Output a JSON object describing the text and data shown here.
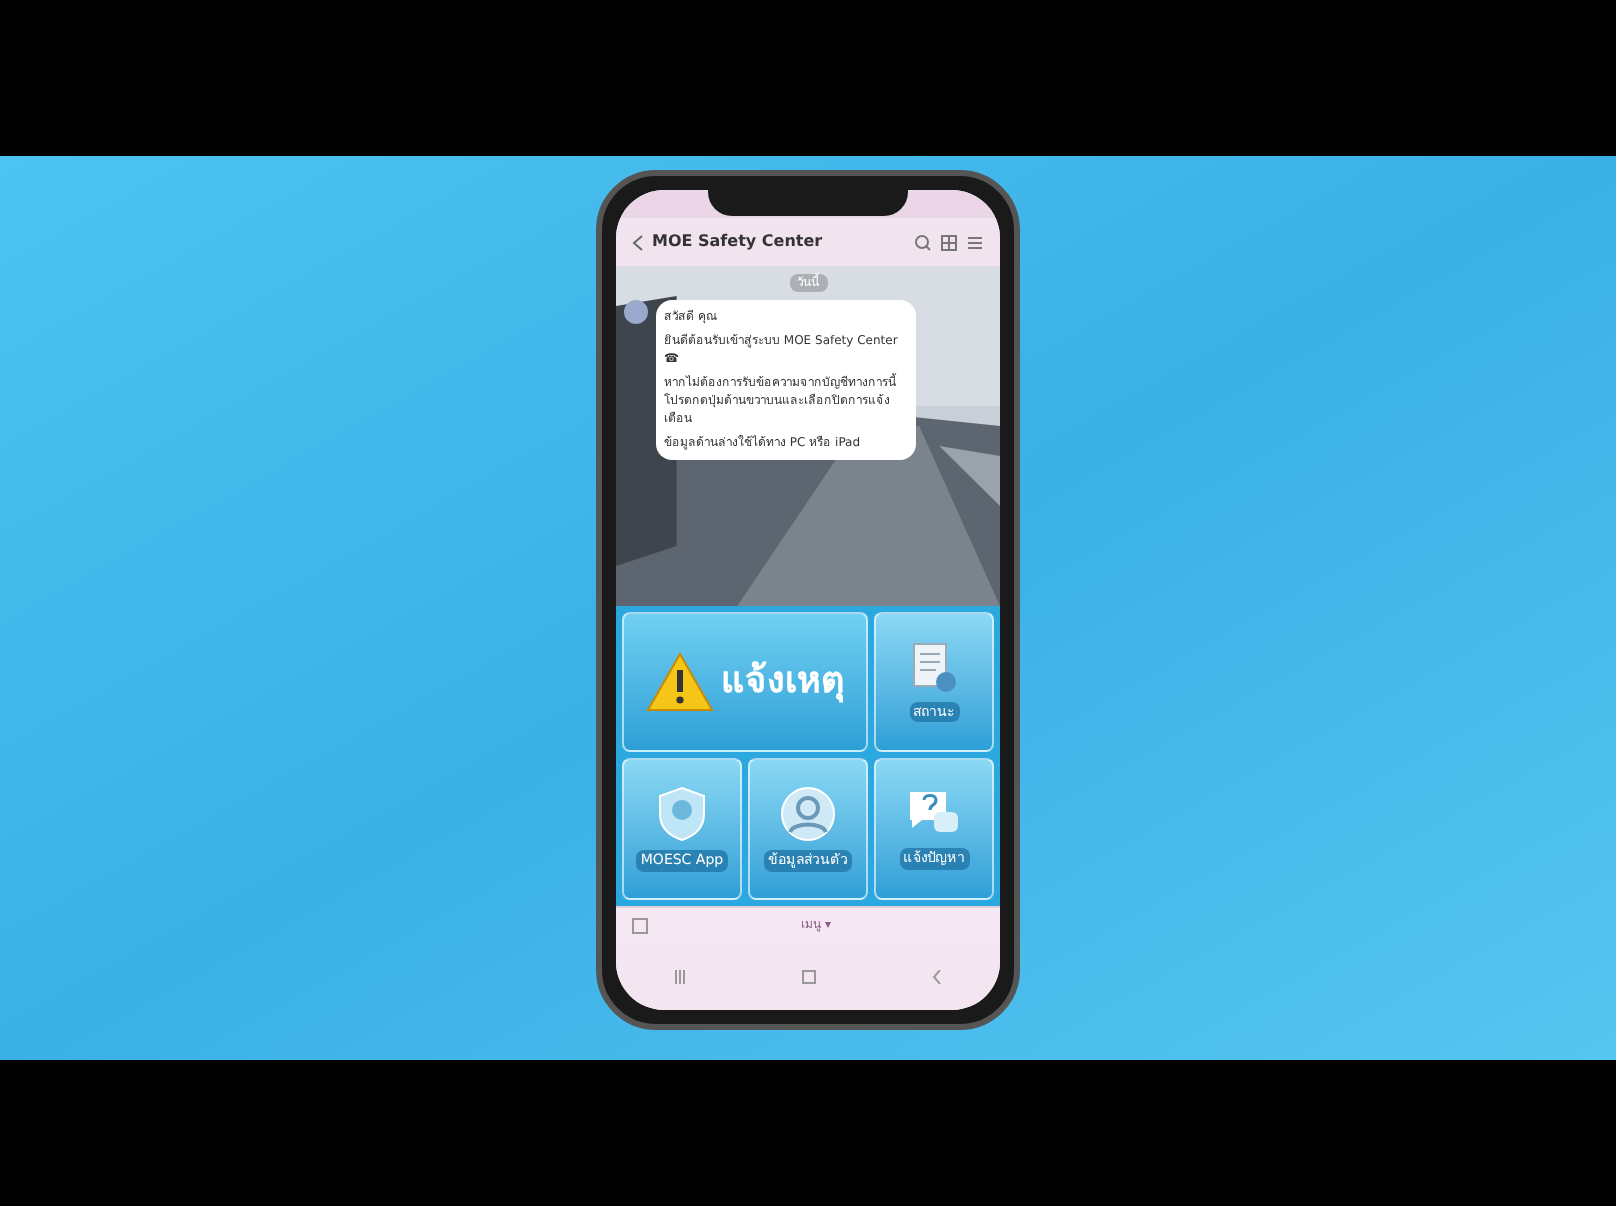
{
  "chat": {
    "title": "MOE Safety Center",
    "date": "วันนี้",
    "message": {
      "sender": "สวัสดี คุณ",
      "lines": [
        "ยินดีต้อนรับเข้าสู่ระบบ MOE Safety Center ☎",
        "หากไม่ต้องการรับข้อความจากบัญชีทางการนี้ โปรดกดปุ่มด้านขวาบนและเลือกปิดการแจ้งเตือน",
        "ข้อมูลด้านล่างใช้ได้ทาง PC หรือ iPad"
      ]
    }
  },
  "rich_menu": [
    {
      "kind": "report",
      "label": "แจ้งเหตุ"
    },
    {
      "kind": "status",
      "label": "สถานะ"
    },
    {
      "kind": "app",
      "label": "MOESC App"
    },
    {
      "kind": "profile",
      "label": "ข้อมูลส่วนตัว"
    },
    {
      "kind": "help",
      "label": "แจ้งปัญหา"
    }
  ],
  "menu_toggle": "เมนู ▾"
}
